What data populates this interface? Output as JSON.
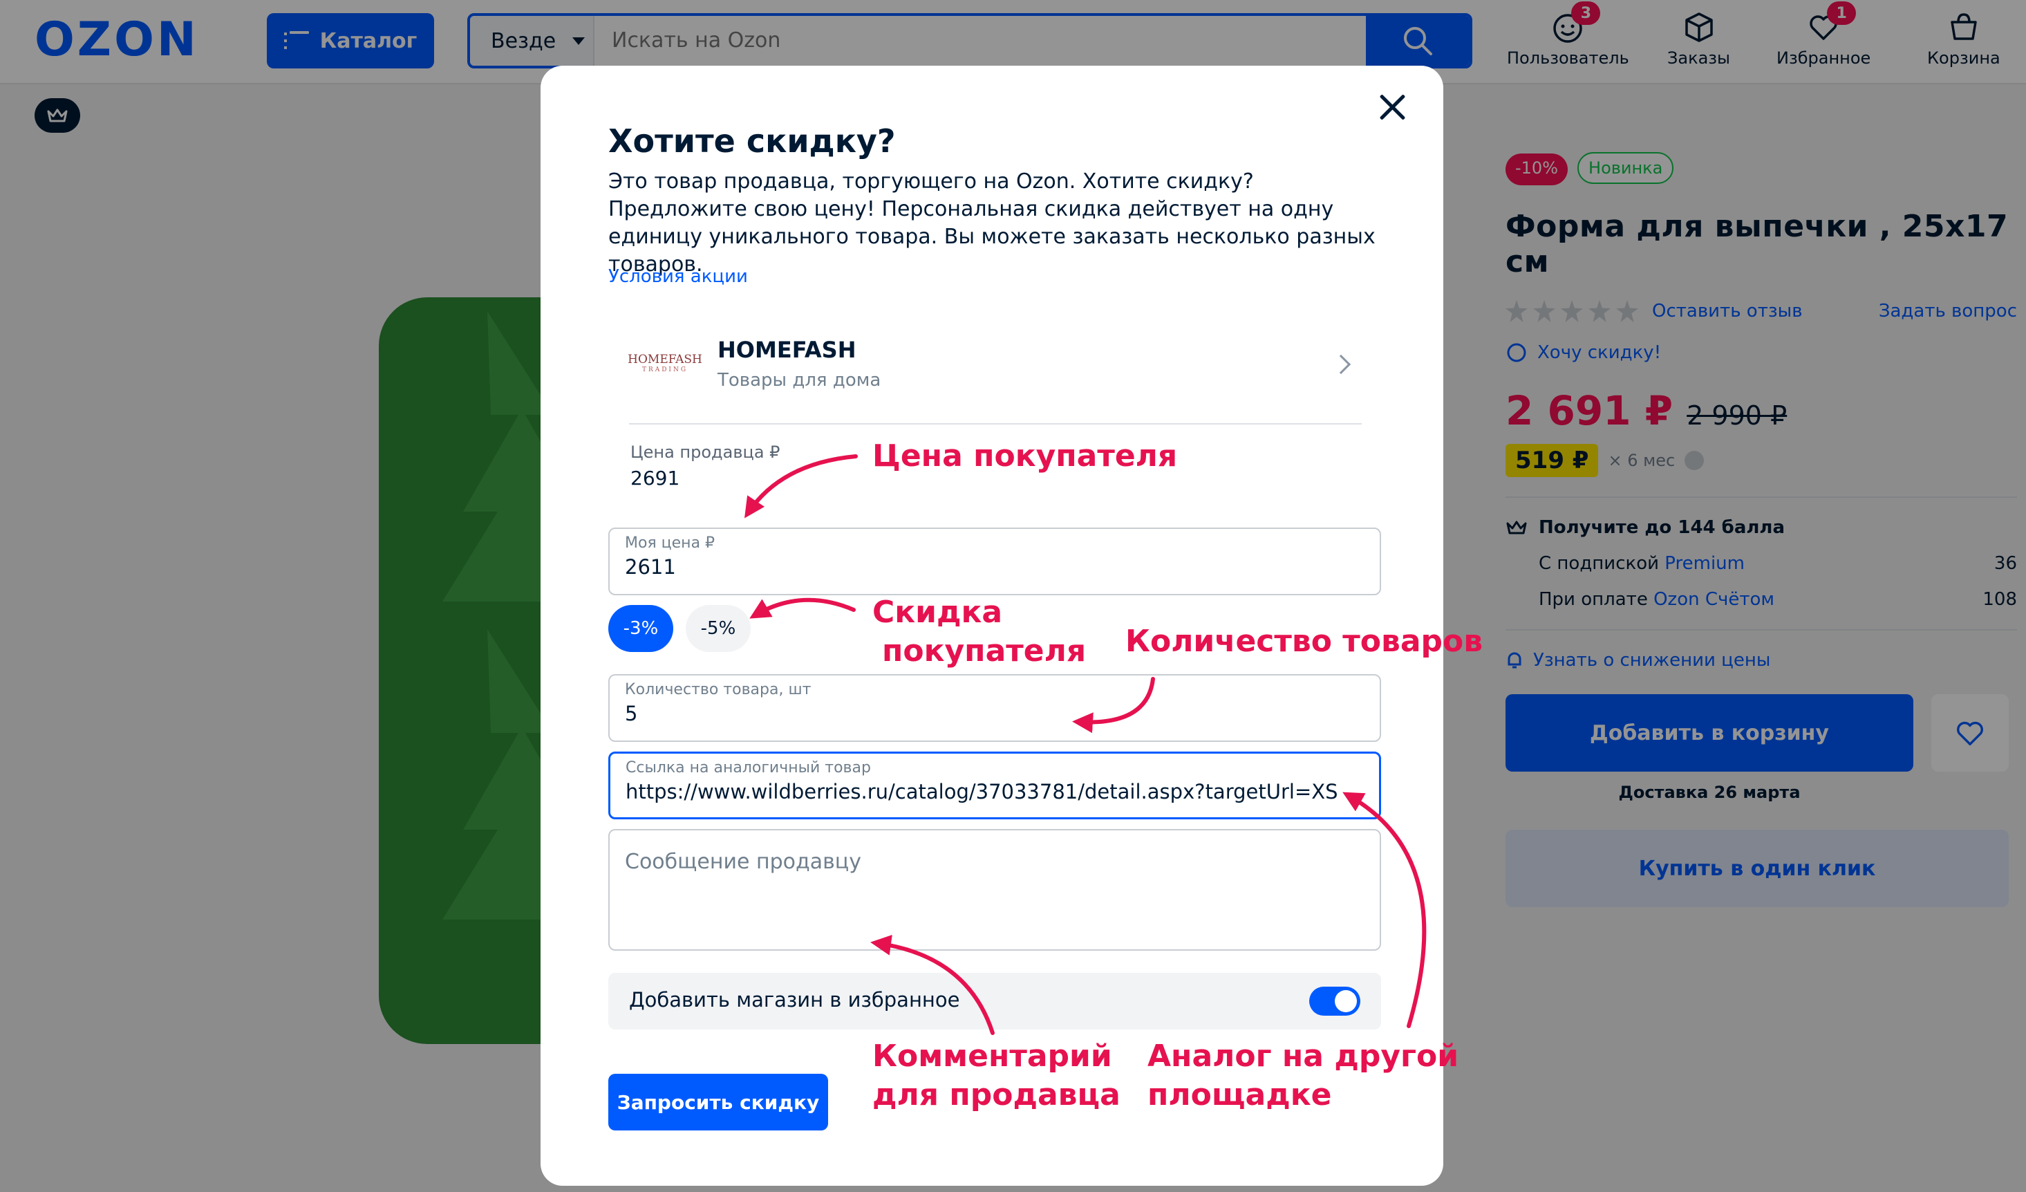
{
  "header": {
    "logo": "OZON",
    "catalog_label": "Каталог",
    "search_scope": "Везде",
    "search_placeholder": "Искать на Ozon",
    "nav": [
      {
        "label": "Пользователь",
        "badge": "3",
        "icon": "user-icon"
      },
      {
        "label": "Заказы",
        "badge": "",
        "icon": "box-icon"
      },
      {
        "label": "Избранное",
        "badge": "1",
        "icon": "heart-icon"
      },
      {
        "label": "Корзина",
        "badge": "",
        "icon": "cart-icon"
      }
    ]
  },
  "product": {
    "discount_tag": "-10%",
    "new_tag": "Новинка",
    "title": "Форма для выпечки , 25х17 см",
    "leave_review": "Оставить отзыв",
    "ask_question": "Задать вопрос",
    "want_discount": "Хочу скидку!",
    "price": "2 691 ₽",
    "old_price": "2 990 ₽",
    "installment_price": "519 ₽",
    "installment_term": "× 6 мес",
    "bonus_title": "Получите до 144 балла",
    "bonus_lines": [
      {
        "prefix": "С подпиской ",
        "link": "Premium",
        "value": "36"
      },
      {
        "prefix": "При оплате ",
        "link": "Ozon Счётом",
        "value": "108"
      }
    ],
    "price_drop": "Узнать о снижении цены",
    "add_to_cart": "Добавить в корзину",
    "delivery": "Доставка 26 марта",
    "one_click": "Купить в один клик"
  },
  "modal": {
    "title": "Хотите скидку?",
    "description": "Это товар продавца, торгующего на Ozon. Хотите скидку? Предложите свою цену! Персональная скидка действует на одну единицу уникального товара. Вы можете заказать несколько разных товаров.",
    "terms_link": "Условия акции",
    "seller": {
      "logo_text": "HOMEFASH",
      "logo_sub": "TRADING",
      "name": "HOMEFASH",
      "subtitle": "Товары для дома"
    },
    "seller_price_label": "Цена продавца ₽",
    "seller_price_value": "2691",
    "my_price_label": "Моя цена ₽",
    "my_price_value": "2611",
    "chips": [
      "-3%",
      "-5%"
    ],
    "qty_label": "Количество товара, шт",
    "qty_value": "5",
    "link_label": "Ссылка на аналогичный товар",
    "link_value": "https://www.wildberries.ru/catalog/37033781/detail.aspx?targetUrl=XS",
    "message_placeholder": "Сообщение продавцу",
    "favorite_store": "Добавить магазин в избранное",
    "favorite_store_on": true,
    "submit": "Запросить скидку"
  },
  "annotations": {
    "buyer_price": "Цена покупателя",
    "buyer_discount_1": "Скидка",
    "buyer_discount_2": "покупателя",
    "quantity": "Количество товаров",
    "comment_1": "Комментарий",
    "comment_2": "для продавца",
    "analog_1": "Аналог на другой",
    "analog_2": "площадке"
  },
  "colors": {
    "brand_blue": "#005bff",
    "accent_pink": "#f91155",
    "annotation_red": "#e6124f"
  }
}
